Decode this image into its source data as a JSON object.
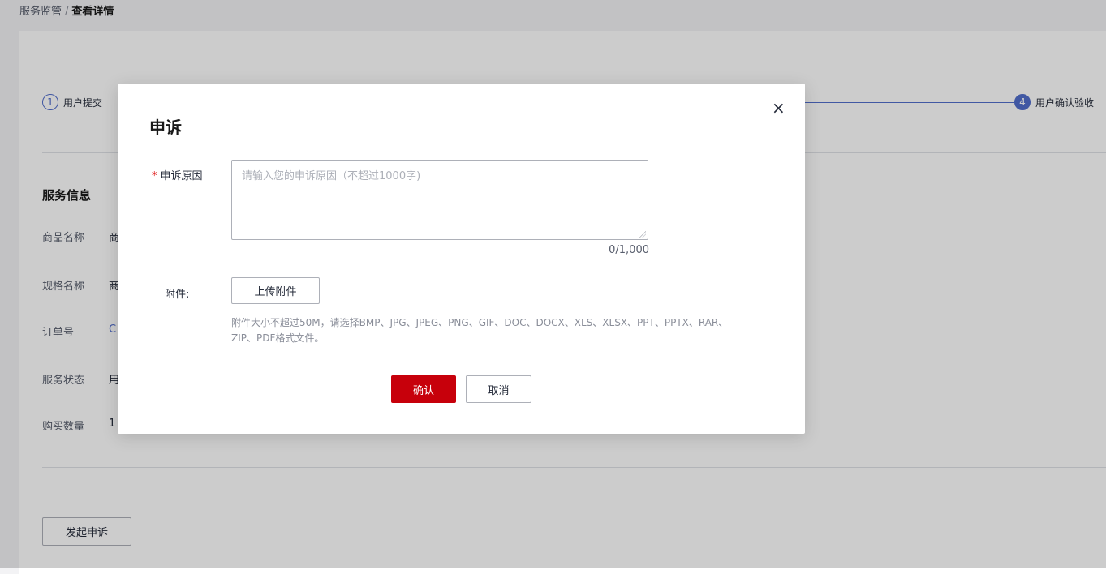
{
  "breadcrumb": {
    "parent": "服务监管",
    "separator": "/",
    "current": "查看详情"
  },
  "steps": [
    {
      "num": "1",
      "label": "用户提交"
    },
    {
      "num": "4",
      "label": "用户确认验收"
    }
  ],
  "service_info": {
    "title": "服务信息",
    "rows": [
      {
        "label": "商品名称",
        "value": "商"
      },
      {
        "label": "规格名称",
        "value": "商"
      },
      {
        "label": "订单号",
        "value": "C"
      },
      {
        "label": "服务状态",
        "value": "用"
      },
      {
        "label": "购买数量",
        "value": "1"
      }
    ]
  },
  "appeal_button": "发起申诉",
  "modal": {
    "title": "申诉",
    "close_icon": "×",
    "reason_required_mark": "*",
    "reason_label": "申诉原因",
    "reason_placeholder": "请输入您的申诉原因（不超过1000字)",
    "reason_value": "",
    "counter": "0/1,000",
    "attachment_label": "附件:",
    "upload_button": "上传附件",
    "hint": "附件大小不超过50M，请选择BMP、JPG、JPEG、PNG、GIF、DOC、DOCX、XLS、XLSX、PPT、PPTX、RAR、ZIP、PDF格式文件。",
    "confirm_button": "确认",
    "cancel_button": "取消"
  },
  "colors": {
    "primary": "#c7000b",
    "step_accent": "#526ecc",
    "required": "#e02020"
  }
}
